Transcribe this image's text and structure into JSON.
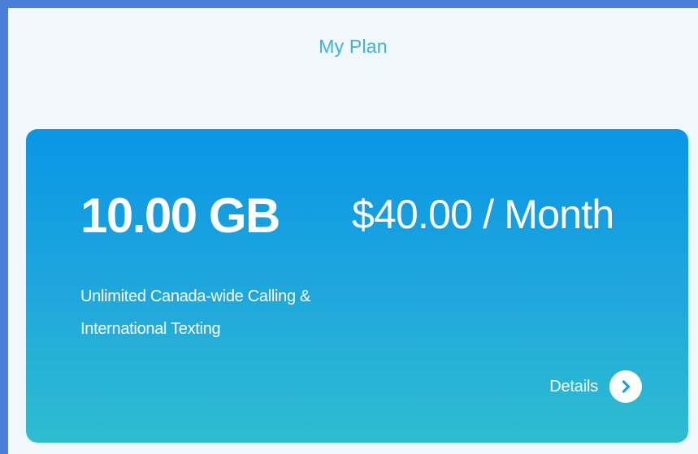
{
  "page": {
    "title": "My Plan"
  },
  "plan": {
    "data_amount": "10.00 GB",
    "price": "$40.00 / Month",
    "description_line1": "Unlimited Canada-wide Calling &",
    "description_line2": "International Texting",
    "details_label": "Details",
    "details_icon": "chevron-right-circle"
  },
  "colors": {
    "frame": "#4a7fd8",
    "background": "#f1f8fc",
    "title": "#3bb3d6",
    "card_top": "#0996e6",
    "card_bottom": "#2ebdd0",
    "card_text": "#ffffff"
  }
}
